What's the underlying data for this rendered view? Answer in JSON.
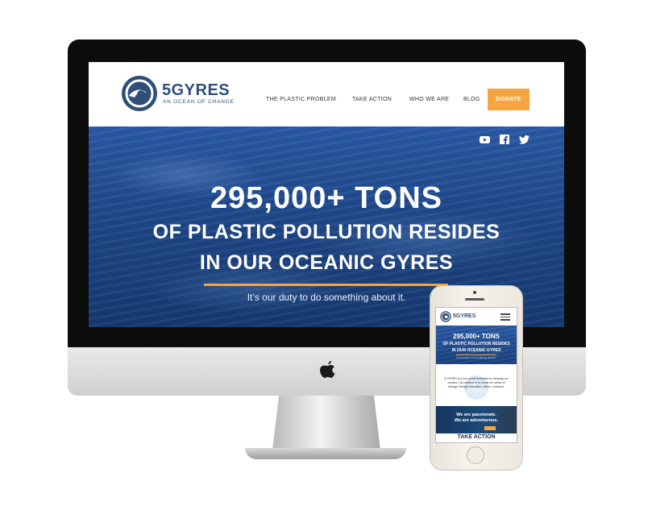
{
  "site": {
    "logo_name": "5GYRES",
    "logo_tagline": "AN OCEAN OF CHANGE"
  },
  "nav": {
    "items": [
      {
        "label": "THE PLASTIC PROBLEM"
      },
      {
        "label": "TAKE ACTION"
      },
      {
        "label": "WHO WE ARE"
      },
      {
        "label": "BLOG"
      }
    ],
    "donate_label": "DONATE"
  },
  "social": [
    "youtube-icon",
    "facebook-icon",
    "twitter-icon"
  ],
  "hero": {
    "line1": "295,000+ TONS",
    "line2": "OF PLASTIC POLLUTION RESIDES",
    "line3": "IN OUR OCEANIC GYRES",
    "subtitle": "It’s our duty to do something about it."
  },
  "mobile": {
    "logo_name": "5GYRES",
    "hero_line1": "295,000+ TONS",
    "hero_line2": "OF PLASTIC POLLUTION RESIDES",
    "hero_line3": "IN OUR OCEANIC GYRES",
    "hero_sub": "It’s our duty to do something about it.",
    "about_text": "5 GYRES is a non-profit dedicated to cleaning our oceans. Our mission is to create an ocean of change through education, action, outreach.",
    "band_line1": "We are passionate.",
    "band_line2": "We are adventurous.",
    "take_action_heading": "TAKE ACTION"
  },
  "colors": {
    "accent_orange": "#f7a541",
    "brand_navy": "#2f4f78",
    "ocean_blue": "#1d4585"
  }
}
